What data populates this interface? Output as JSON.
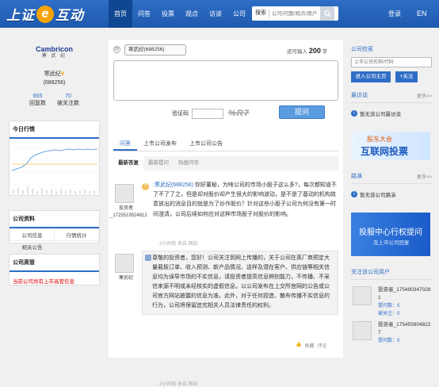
{
  "header": {
    "logo_text_left": "上证",
    "logo_text_e": "e",
    "logo_text_right": "互动",
    "nav": [
      "首页",
      "问答",
      "投票",
      "观点",
      "访谈",
      "公司"
    ],
    "search_label": "搜索",
    "search_placeholder": "公司/问题/观点/用户",
    "login": "登录",
    "lang": "EN"
  },
  "company": {
    "logo_en": "Cambricon",
    "logo_cn": "寒 武 纪",
    "name": "寒武纪",
    "verified": "V",
    "code": "(688256)",
    "answers_count": "665",
    "followers_count": "70",
    "answers_label": "回复数",
    "followers_label": "被关注数"
  },
  "left": {
    "quote_title": "今日行情",
    "data_title": "公司资料",
    "data_items": [
      [
        "公司信息",
        "行情统计"
      ],
      [
        "相关公告",
        ""
      ]
    ],
    "notice_title": "公司高管",
    "notice_text": "当前公司尚有上市高管信息"
  },
  "ask": {
    "target": "寒武纪(688256)",
    "char_hint_prefix": "还可输入",
    "char_hint_count": "200",
    "char_hint_suffix": "字",
    "verify_label": "验证码",
    "captcha": "%R7",
    "submit": "提问"
  },
  "tabs": [
    "问答",
    "上市公司发布",
    "上市公司公告"
  ],
  "subtabs": [
    "最新答复",
    "最新提问",
    "热搜问答"
  ],
  "qa": [
    {
      "user": "投资者_1725519524612",
      "question_at": ":寒武纪(688256)",
      "question": "你好董秘，为啥公司的市场小股子这么多?，每次都知道不了不了了之，但是却对股价却产生很大的影响波动，是不是了基动的机构故意放出的消息目的就是为了炒作股价？针对这些小股子公司为何没有第一时间澄清，公司后续如何应对这种市场股子对股价的影响。",
      "meta": "2小时前 来自 网站",
      "answerer": "寒武纪",
      "answer": "尊敬的投资者，您好！公司关注到网上传播的，关于公司在英厂商预定大量载板订单、收入预测、新产品情况、送样及潜在客户、供应链等相关信息均为误导市场的不实信息，请投资者提高信息辨别能力，不传播、不采信来源不明或未经核实的虚假信息。以公司发布在上交所官网的公告或公司官方网站披露的信息为准。此外，对于任何捏造、散布传播不实信息的行为，公司将保留追究相关人员法律责任的权利。",
      "answer_meta": "2小时前 来自 网站",
      "actions": [
        "收藏",
        "评论"
      ]
    }
  ],
  "right": {
    "search_title": "公司检索",
    "search_placeholder": "上市公司名称/代码",
    "btn_enter": "进入公司主页",
    "btn_follow": "+关注",
    "interview_title": "最访谈",
    "more": "更多>>",
    "interview_empty": "暂无该公司最访谈",
    "banner1_t1": "股东大会",
    "banner1_t2": "互联网投票",
    "roadshow_title": "路演",
    "roadshow_empty": "暂无该公司路演",
    "banner2_t1": "投服中心行权提问",
    "banner2_t2": "及上市公司回复",
    "followers_title": "关注该公司用户",
    "followers": [
      {
        "name": "投资者_1754903470281",
        "q": "提问数：0",
        "f": "被关注：0"
      },
      {
        "name": "投资者_1754559048227",
        "q": "提问数：0",
        "f": ""
      }
    ]
  }
}
